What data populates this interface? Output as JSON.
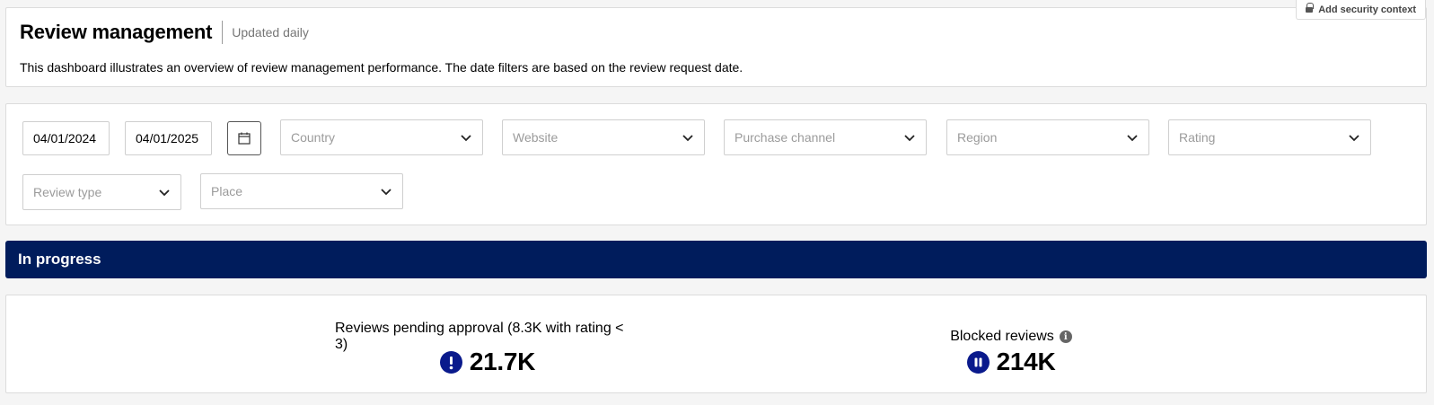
{
  "header": {
    "title": "Review management",
    "subtitle": "Updated daily",
    "description": "This dashboard illustrates an overview of review management performance. The date filters are based on the review request date.",
    "security_button_label": "Add security context"
  },
  "filters": {
    "start_date": "04/01/2024",
    "end_date": "04/01/2025",
    "selects": [
      {
        "placeholder": "Country"
      },
      {
        "placeholder": "Website"
      },
      {
        "placeholder": "Purchase channel"
      },
      {
        "placeholder": "Region"
      },
      {
        "placeholder": "Rating"
      },
      {
        "placeholder": "Review type"
      },
      {
        "placeholder": "Place"
      }
    ]
  },
  "section": {
    "title": "In progress",
    "color": "#001c5c"
  },
  "kpis": [
    {
      "label": "Reviews pending approval (8.3K with rating < 3)",
      "value": "21.7K",
      "icon": "exclamation-icon"
    },
    {
      "label": "Blocked reviews",
      "value": "214K",
      "icon": "pause-icon",
      "info_icon": "info-icon"
    }
  ],
  "colors": {
    "accent": "#0a1a8c",
    "background": "#f5f5f5"
  }
}
